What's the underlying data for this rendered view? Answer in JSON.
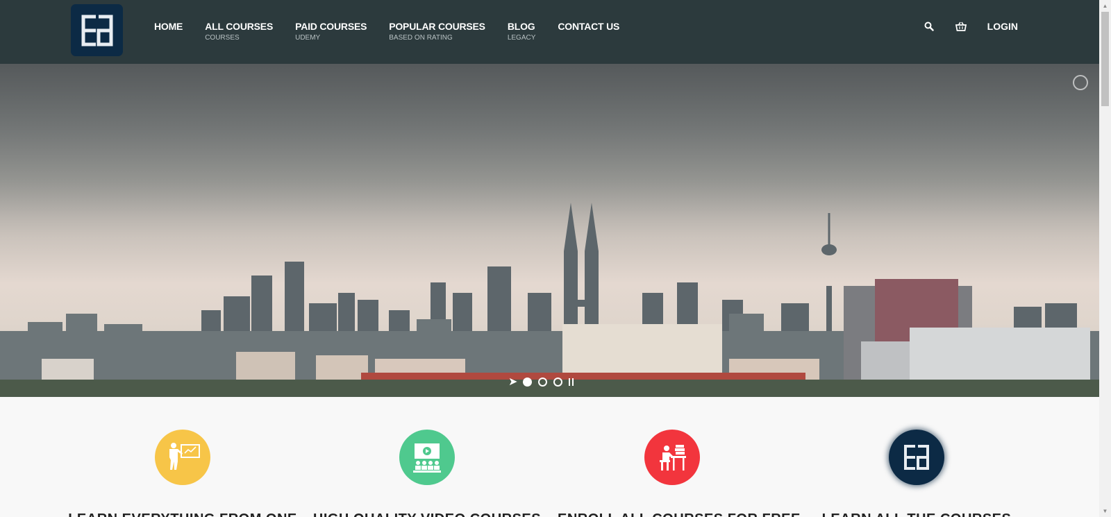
{
  "header": {
    "logo_text": "ea",
    "nav": [
      {
        "label": "HOME",
        "sub": ""
      },
      {
        "label": "ALL COURSES",
        "sub": "COURSES"
      },
      {
        "label": "PAID COURSES",
        "sub": "UDEMY"
      },
      {
        "label": "POPULAR COURSES",
        "sub": "BASED ON RATING"
      },
      {
        "label": "BLOG",
        "sub": "LEGACY"
      },
      {
        "label": "CONTACT US",
        "sub": ""
      }
    ],
    "search_icon": "search-icon",
    "cart_icon": "basket-icon",
    "login_label": "LOGIN"
  },
  "slider": {
    "slides": 3,
    "active_slide": 1
  },
  "features": [
    {
      "icon": "teacher-icon",
      "color": "#f7c548",
      "title": "LEARN EVERYTHING FROM ONE"
    },
    {
      "icon": "video-class-icon",
      "color": "#4fc98e",
      "title": "HIGH QUALITY VIDEO COURSES"
    },
    {
      "icon": "student-desk-icon",
      "color": "#f2353d",
      "title": "ENROLL ALL COURSES FOR FREE"
    },
    {
      "icon": "ea-logo-icon",
      "color": "#0c2a45",
      "title": "LEARN ALL THE COURSES"
    }
  ],
  "colors": {
    "header_bg": "#2c3a3d",
    "logo_bg": "#0c2a45"
  }
}
